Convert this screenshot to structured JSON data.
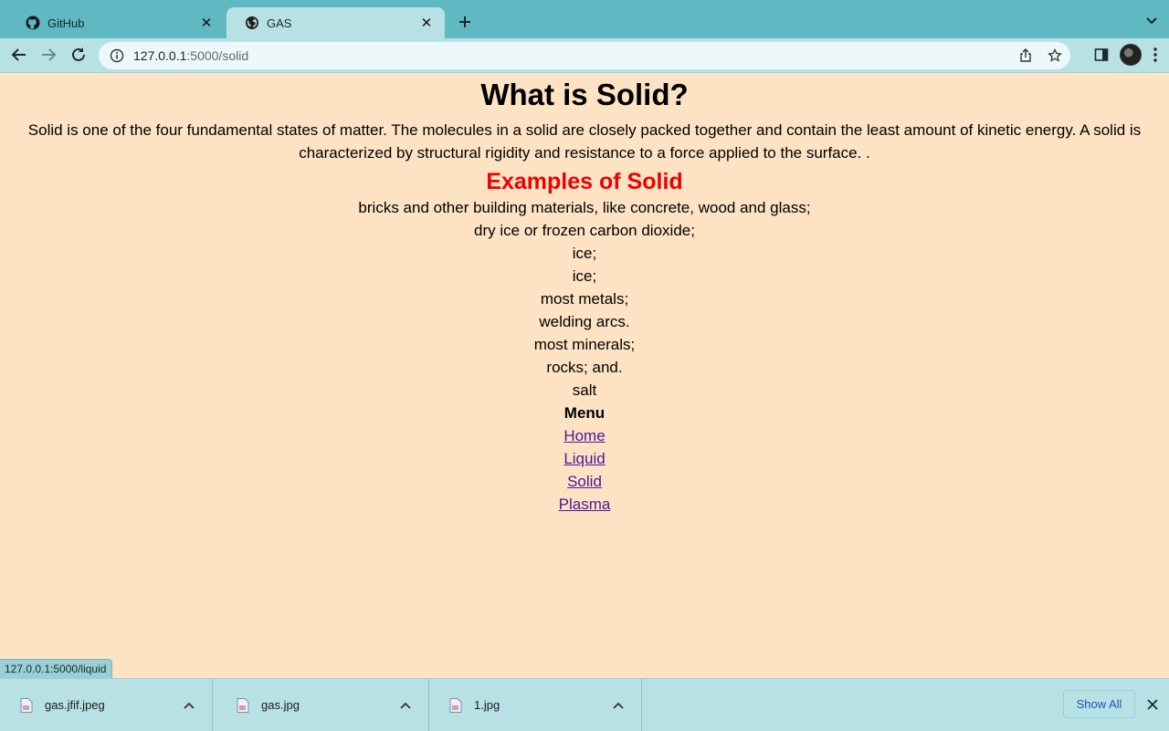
{
  "browser": {
    "tabs": [
      {
        "label": "GitHub",
        "icon": "github-icon"
      },
      {
        "label": "GAS",
        "icon": "globe-icon"
      }
    ],
    "url_host": "127.0.0.1",
    "url_path": ":5000/solid",
    "status_url": "127.0.0.1:5000/liquid"
  },
  "page": {
    "title": "What is Solid?",
    "intro": "Solid is one of the four fundamental states of matter. The molecules in a solid are closely packed together and contain the least amount of kinetic energy. A solid is characterized by structural rigidity and resistance to a force applied to the surface. .",
    "examples_heading": "Examples of Solid",
    "examples": [
      "bricks and other building materials, like concrete, wood and glass;",
      "dry ice or frozen carbon dioxide;",
      "ice;",
      "ice;",
      "most metals;",
      "welding arcs.",
      "most minerals;",
      "rocks; and.",
      "salt"
    ],
    "menu_title": "Menu",
    "menu": [
      "Home",
      "Liquid",
      "Solid",
      "Plasma"
    ]
  },
  "downloads": {
    "items": [
      "gas.jfif.jpeg",
      "gas.jpg",
      "1.jpg"
    ],
    "show_all": "Show All"
  },
  "colors": {
    "tabstrip": "#5fb8c2",
    "toolbar": "#b8e1e5",
    "page_bg": "#fde3c4",
    "heading_red": "#ef0000",
    "link": "#4b1896"
  }
}
